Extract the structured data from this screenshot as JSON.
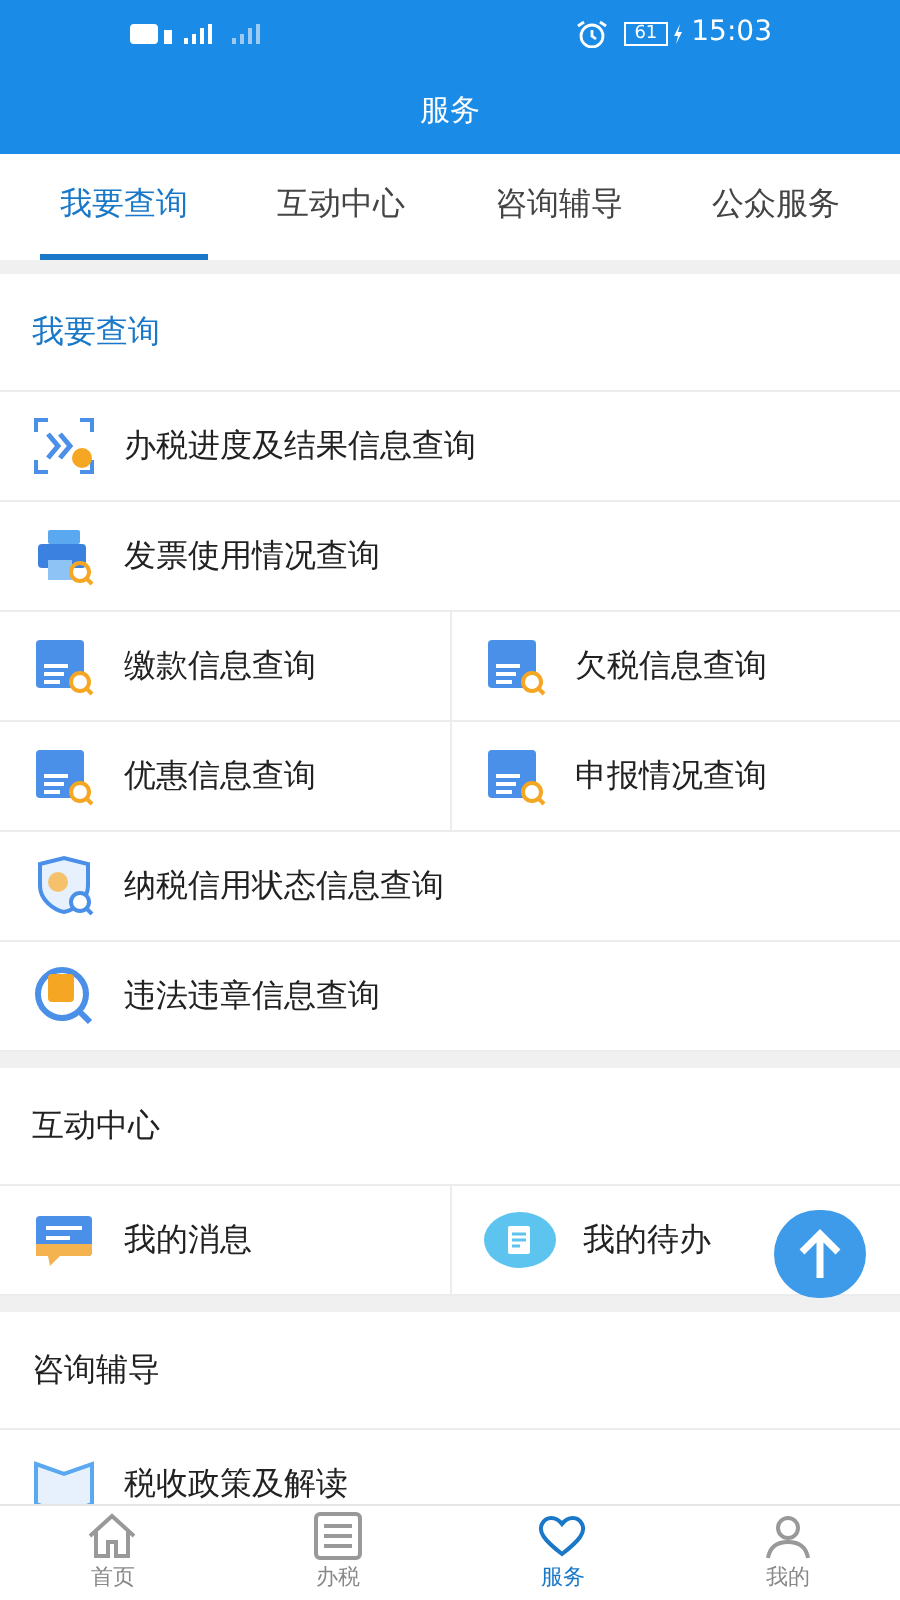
{
  "status_bar": {
    "battery": "61",
    "time": "15:03"
  },
  "header": {
    "title": "服务"
  },
  "tabs": [
    {
      "label": "我要查询",
      "selected": true
    },
    {
      "label": "互动中心",
      "selected": false
    },
    {
      "label": "咨询辅导",
      "selected": false
    },
    {
      "label": "公众服务",
      "selected": false
    }
  ],
  "sections": [
    {
      "title": "我要查询",
      "highlighted": true,
      "rows": [
        [
          {
            "label": "办税进度及结果信息查询",
            "kind": "progress"
          }
        ],
        [
          {
            "label": "发票使用情况查询",
            "kind": "printer"
          }
        ],
        [
          {
            "label": "缴款信息查询",
            "kind": "doc"
          },
          {
            "label": "欠税信息查询",
            "kind": "doc"
          }
        ],
        [
          {
            "label": "优惠信息查询",
            "kind": "doc"
          },
          {
            "label": "申报情况查询",
            "kind": "doc"
          }
        ],
        [
          {
            "label": "纳税信用状态信息查询",
            "kind": "shield"
          }
        ],
        [
          {
            "label": "违法违章信息查询",
            "kind": "circle"
          }
        ]
      ]
    },
    {
      "title": "互动中心",
      "highlighted": false,
      "rows": [
        [
          {
            "label": "我的消息",
            "kind": "message"
          },
          {
            "label": "我的待办",
            "kind": "todo"
          }
        ]
      ]
    },
    {
      "title": "咨询辅导",
      "highlighted": false,
      "rows": [
        [
          {
            "label": "税收政策及解读",
            "kind": "book"
          }
        ]
      ]
    }
  ],
  "nav": [
    {
      "label": "首页",
      "selected": false
    },
    {
      "label": "办税",
      "selected": false
    },
    {
      "label": "服务",
      "selected": true
    },
    {
      "label": "我的",
      "selected": false
    }
  ]
}
